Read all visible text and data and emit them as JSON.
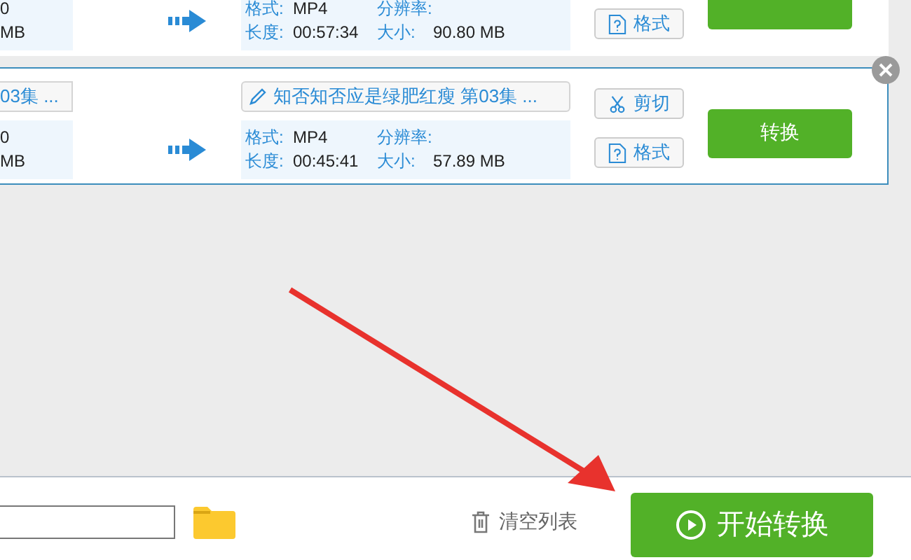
{
  "files": [
    {
      "selected": false,
      "source": {
        "lines": [
          "0",
          "MB"
        ]
      },
      "info": {
        "format_label": "格式:",
        "format": "MP4",
        "resolution_label": "分辨率:",
        "duration_label": "长度:",
        "duration": "00:57:34",
        "size_label": "大小:",
        "size": "90.80 MB"
      },
      "buttons": [
        {
          "kind": "format",
          "label": "格式"
        }
      ]
    },
    {
      "selected": true,
      "source": {
        "name": "03集 ...",
        "lines": [
          "0",
          "MB"
        ]
      },
      "output_name": "知否知否应是绿肥红瘦 第03集 ...",
      "info": {
        "format_label": "格式:",
        "format": "MP4",
        "resolution_label": "分辨率:",
        "duration_label": "长度:",
        "duration": "00:45:41",
        "size_label": "大小:",
        "size": "57.89 MB"
      },
      "buttons": [
        {
          "kind": "cut",
          "label": "剪切"
        },
        {
          "kind": "format",
          "label": "格式"
        }
      ],
      "convert": "转换"
    }
  ],
  "footer": {
    "clear": "清空列表",
    "start": "开始转换"
  }
}
